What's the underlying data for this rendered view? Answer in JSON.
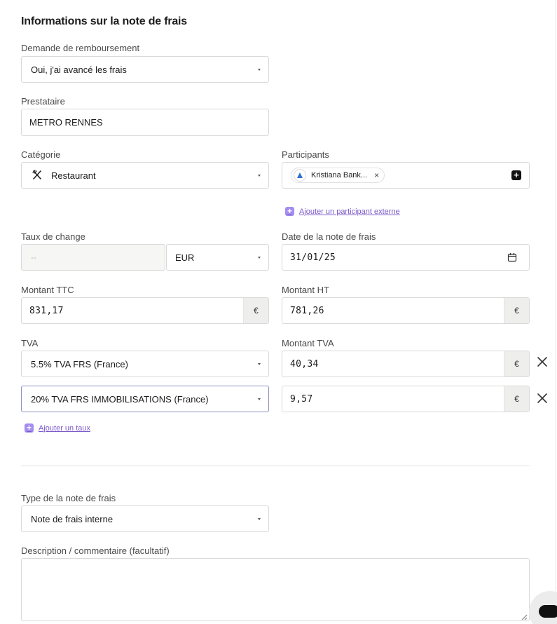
{
  "section_title": "Informations sur la note de frais",
  "reimbursement": {
    "label": "Demande de remboursement",
    "value": "Oui, j'ai avancé les frais"
  },
  "provider": {
    "label": "Prestataire",
    "value": "METRO RENNES"
  },
  "category": {
    "label": "Catégorie",
    "value": "Restaurant",
    "icon": "fork-knife-icon"
  },
  "participants": {
    "label": "Participants",
    "chip_name": "Kristiana Bank...",
    "chip_remove": "×",
    "add_external": "Ajouter un participant externe"
  },
  "exchange": {
    "label": "Taux de change",
    "rate_placeholder": "--",
    "currency": "EUR"
  },
  "date": {
    "label": "Date de la note de frais",
    "value": "31/01/25"
  },
  "amount_ttc": {
    "label": "Montant TTC",
    "value": "831,17",
    "currency_symbol": "€"
  },
  "amount_ht": {
    "label": "Montant HT",
    "value": "781,26",
    "currency_symbol": "€"
  },
  "vat": {
    "label": "TVA",
    "amount_label": "Montant TVA",
    "rows": [
      {
        "rate": "5.5% TVA FRS (France)",
        "amount": "40,34",
        "currency_symbol": "€"
      },
      {
        "rate": "20% TVA FRS IMMOBILISATIONS (France)",
        "amount": "9,57",
        "currency_symbol": "€"
      }
    ],
    "add_rate": "Ajouter un taux"
  },
  "expense_type": {
    "label": "Type de la note de frais",
    "value": "Note de frais interne"
  },
  "description": {
    "label": "Description / commentaire (facultatif)",
    "value": ""
  },
  "colors": {
    "accent": "#7b59c9",
    "accent_light": "#a48cf0",
    "border": "#d9d9d9",
    "suffix_bg": "#eeeeec"
  }
}
